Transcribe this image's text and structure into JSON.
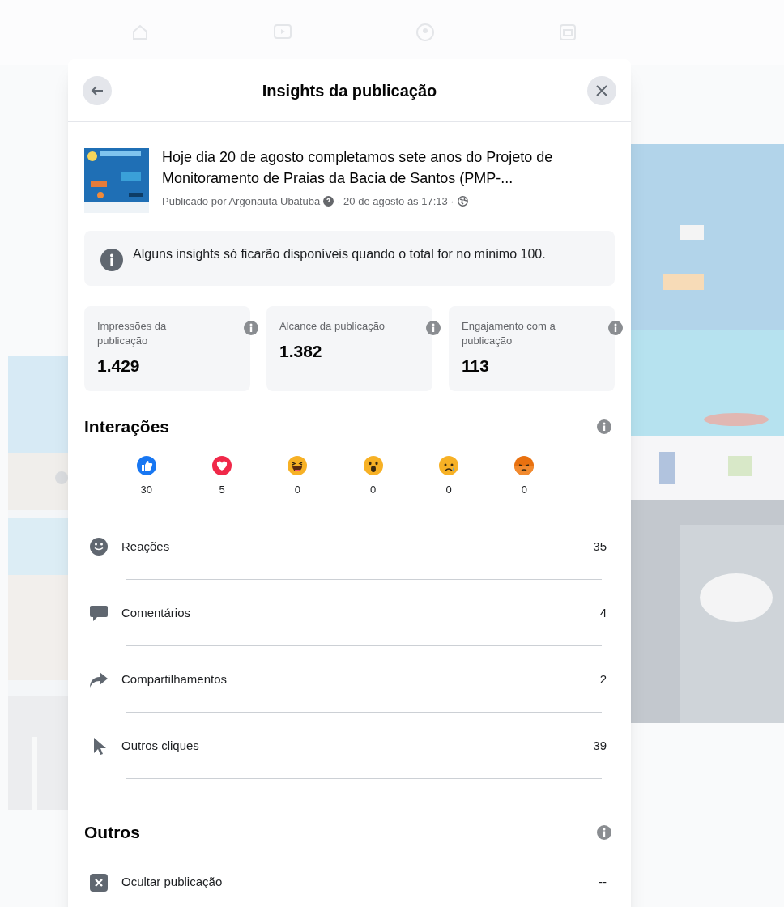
{
  "dialog": {
    "title": "Insights da publicação"
  },
  "post": {
    "text": "Hoje dia 20 de agosto completamos sete anos do Projeto de Monitoramento de Praias da Bacia de Santos (PMP-...",
    "author": "Publicado por Argonauta Ubatuba",
    "date": "· 20 de agosto às 17:13 ·"
  },
  "notice": "Alguns insights só ficarão disponíveis quando o total for no mínimo 100.",
  "metrics": [
    {
      "label": "Impressões da publicação",
      "value": "1.429"
    },
    {
      "label": "Alcance da publicação",
      "value": "1.382"
    },
    {
      "label": "Engajamento com a publicação",
      "value": "113"
    }
  ],
  "interactions": {
    "title": "Interações",
    "reactions": [
      {
        "kind": "like",
        "count": "30"
      },
      {
        "kind": "love",
        "count": "5"
      },
      {
        "kind": "haha",
        "count": "0"
      },
      {
        "kind": "wow",
        "count": "0"
      },
      {
        "kind": "sad",
        "count": "0"
      },
      {
        "kind": "angry",
        "count": "0"
      }
    ],
    "rows": [
      {
        "kind": "reactions",
        "label": "Reações",
        "value": "35"
      },
      {
        "kind": "comments",
        "label": "Comentários",
        "value": "4"
      },
      {
        "kind": "shares",
        "label": "Compartilhamentos",
        "value": "2"
      },
      {
        "kind": "clicks",
        "label": "Outros cliques",
        "value": "39"
      }
    ]
  },
  "others": {
    "title": "Outros",
    "rows": [
      {
        "kind": "hide",
        "label": "Ocultar publicação",
        "value": "--"
      }
    ]
  }
}
